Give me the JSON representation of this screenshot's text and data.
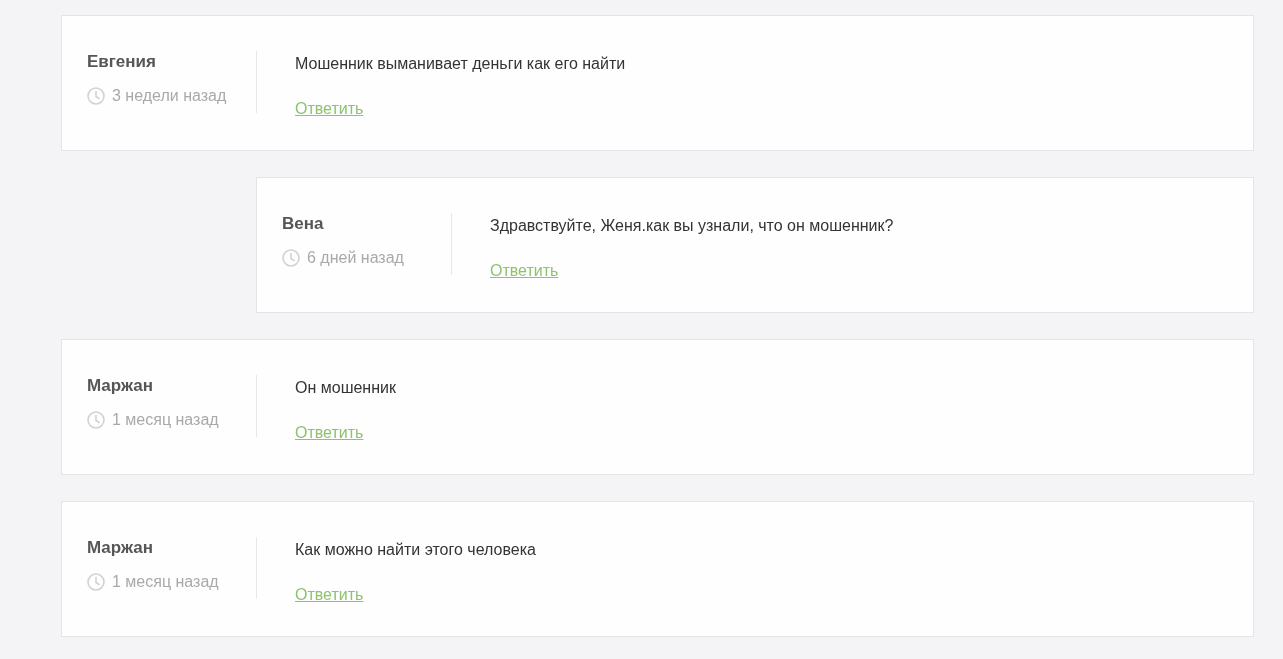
{
  "comments": [
    {
      "author": "Евгения",
      "time": "3 недели назад",
      "text": "Мошенник выманивает деньги как его найти",
      "reply_link": "Ответить",
      "replies": [
        {
          "author": "Вена",
          "time": "6 дней назад",
          "text": "Здравствуйте, Женя.как вы узнали, что он мошенник?",
          "reply_link": "Ответить"
        }
      ]
    },
    {
      "author": "Маржан",
      "time": "1 месяц назад",
      "text": "Он мошенник",
      "reply_link": "Ответить"
    },
    {
      "author": "Маржан",
      "time": "1 месяц назад",
      "text": "Как можно найти этого человека",
      "reply_link": "Ответить"
    }
  ]
}
